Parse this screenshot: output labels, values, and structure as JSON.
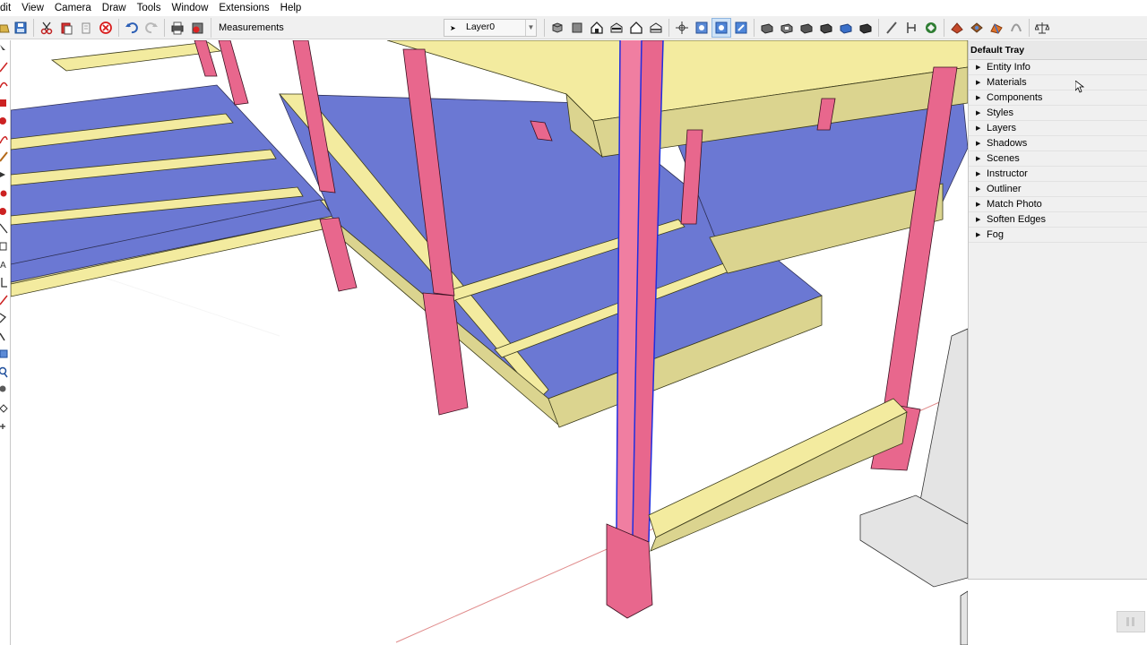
{
  "menubar": {
    "items": [
      "dit",
      "View",
      "Camera",
      "Draw",
      "Tools",
      "Window",
      "Extensions",
      "Help"
    ]
  },
  "toolbar": {
    "measurements_label": "Measurements",
    "layer": {
      "value": "Layer0"
    },
    "left_icons": [
      "open-icon",
      "save-icon",
      "cut-icon",
      "paste-icon",
      "erase-icon",
      "stop-icon",
      "undo-icon",
      "redo-icon",
      "print-icon",
      "model-info-icon"
    ],
    "right_icons": [
      "iso-view-icon",
      "top-view-icon",
      "front-view-icon",
      "right-view-icon",
      "back-view-icon",
      "left-view-icon",
      "orbit-icon",
      "pan-icon",
      "zoom-icon",
      "zoom-extents-icon",
      "xray-icon",
      "wireframe-icon",
      "hidden-line-icon",
      "shaded-icon",
      "shaded-texture-icon",
      "monochrome-icon",
      "section-plane-icon",
      "section-display-icon",
      "warehouse-icon",
      "extension-warehouse-icon",
      "layout-icon",
      "sandbox-icon",
      "style-builder-icon",
      "scale-icon"
    ]
  },
  "tray": {
    "title": "Default Tray",
    "panels": [
      "Entity Info",
      "Materials",
      "Components",
      "Styles",
      "Layers",
      "Shadows",
      "Scenes",
      "Instructor",
      "Outliner",
      "Match Photo",
      "Soften Edges",
      "Fog"
    ]
  },
  "colors": {
    "slab": "#6b78d3",
    "beam": "#f3eb9f",
    "column": "#e8678d",
    "footing": "#e4e4e4",
    "selection": "#1f2ee0"
  }
}
